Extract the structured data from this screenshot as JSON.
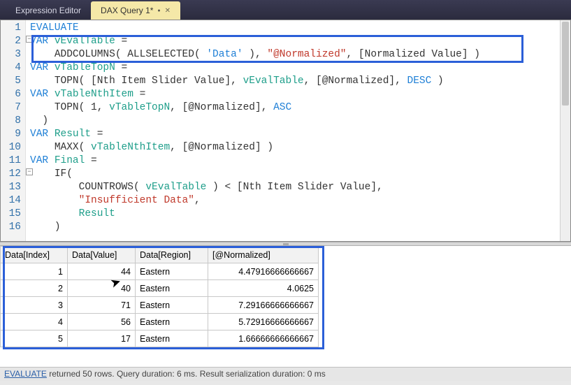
{
  "tabs": {
    "inactive": "Expression Editor",
    "active": "DAX Query 1*"
  },
  "code": {
    "lines": [
      [
        [
          "kw",
          "EVALUATE"
        ]
      ],
      [
        [
          "kw",
          "VAR"
        ],
        [
          "sp",
          " "
        ],
        [
          "ident",
          "vEvalTable"
        ],
        [
          "sp",
          " "
        ],
        [
          "op",
          "="
        ]
      ],
      [
        [
          "sp",
          "    "
        ],
        [
          "func",
          "ADDCOLUMNS"
        ],
        [
          "paren",
          "("
        ],
        [
          "sp",
          " "
        ],
        [
          "func",
          "ALLSELECTED"
        ],
        [
          "paren",
          "("
        ],
        [
          "sp",
          " "
        ],
        [
          "tbl",
          "'Data'"
        ],
        [
          "sp",
          " "
        ],
        [
          "paren",
          ")"
        ],
        [
          "op",
          ", "
        ],
        [
          "str",
          "\"@Normalized\""
        ],
        [
          "op",
          ", "
        ],
        [
          "col",
          "[Normalized Value]"
        ],
        [
          "sp",
          " "
        ],
        [
          "paren",
          ")"
        ]
      ],
      [
        [
          "kw",
          "VAR"
        ],
        [
          "sp",
          " "
        ],
        [
          "ident",
          "vTableTopN"
        ],
        [
          "sp",
          " "
        ],
        [
          "op",
          "="
        ]
      ],
      [
        [
          "sp",
          "    "
        ],
        [
          "func",
          "TOPN"
        ],
        [
          "paren",
          "("
        ],
        [
          "sp",
          " "
        ],
        [
          "col",
          "[Nth Item Slider Value]"
        ],
        [
          "op",
          ", "
        ],
        [
          "ident",
          "vEvalTable"
        ],
        [
          "op",
          ", "
        ],
        [
          "col",
          "[@Normalized]"
        ],
        [
          "op",
          ", "
        ],
        [
          "kw",
          "DESC"
        ],
        [
          "sp",
          " "
        ],
        [
          "paren",
          ")"
        ]
      ],
      [
        [
          "kw",
          "VAR"
        ],
        [
          "sp",
          " "
        ],
        [
          "ident",
          "vTableNthItem"
        ],
        [
          "sp",
          " "
        ],
        [
          "op",
          "="
        ]
      ],
      [
        [
          "sp",
          "    "
        ],
        [
          "func",
          "TOPN"
        ],
        [
          "paren",
          "("
        ],
        [
          "sp",
          " "
        ],
        [
          "num",
          "1"
        ],
        [
          "op",
          ", "
        ],
        [
          "ident",
          "vTableTopN"
        ],
        [
          "op",
          ", "
        ],
        [
          "col",
          "[@Normalized]"
        ],
        [
          "op",
          ", "
        ],
        [
          "kw",
          "ASC"
        ]
      ],
      [
        [
          "sp",
          "  "
        ],
        [
          "paren",
          ")"
        ]
      ],
      [
        [
          "kw",
          "VAR"
        ],
        [
          "sp",
          " "
        ],
        [
          "ident",
          "Result"
        ],
        [
          "sp",
          " "
        ],
        [
          "op",
          "="
        ]
      ],
      [
        [
          "sp",
          "    "
        ],
        [
          "func",
          "MAXX"
        ],
        [
          "paren",
          "("
        ],
        [
          "sp",
          " "
        ],
        [
          "ident",
          "vTableNthItem"
        ],
        [
          "op",
          ", "
        ],
        [
          "col",
          "[@Normalized]"
        ],
        [
          "sp",
          " "
        ],
        [
          "paren",
          ")"
        ]
      ],
      [
        [
          "kw",
          "VAR"
        ],
        [
          "sp",
          " "
        ],
        [
          "ident",
          "Final"
        ],
        [
          "sp",
          " "
        ],
        [
          "op",
          "="
        ]
      ],
      [
        [
          "sp",
          "    "
        ],
        [
          "func",
          "IF"
        ],
        [
          "paren",
          "("
        ]
      ],
      [
        [
          "sp",
          "        "
        ],
        [
          "func",
          "COUNTROWS"
        ],
        [
          "paren",
          "("
        ],
        [
          "sp",
          " "
        ],
        [
          "ident",
          "vEvalTable"
        ],
        [
          "sp",
          " "
        ],
        [
          "paren",
          ")"
        ],
        [
          "sp",
          " "
        ],
        [
          "op",
          "<"
        ],
        [
          "sp",
          " "
        ],
        [
          "col",
          "[Nth Item Slider Value]"
        ],
        [
          "op",
          ","
        ]
      ],
      [
        [
          "sp",
          "        "
        ],
        [
          "brstr",
          "\"Insufficient Data\""
        ],
        [
          "op",
          ","
        ]
      ],
      [
        [
          "sp",
          "        "
        ],
        [
          "ident",
          "Result"
        ]
      ],
      [
        [
          "sp",
          "    "
        ],
        [
          "paren",
          ")"
        ]
      ]
    ]
  },
  "results": {
    "headers": [
      "Data[Index]",
      "Data[Value]",
      "Data[Region]",
      "[@Normalized]"
    ],
    "rows": [
      {
        "index": "1",
        "value": "44",
        "region": "Eastern",
        "norm": "4.47916666666667"
      },
      {
        "index": "2",
        "value": "40",
        "region": "Eastern",
        "norm": "4.0625"
      },
      {
        "index": "3",
        "value": "71",
        "region": "Eastern",
        "norm": "7.29166666666667"
      },
      {
        "index": "4",
        "value": "56",
        "region": "Eastern",
        "norm": "5.72916666666667"
      },
      {
        "index": "5",
        "value": "17",
        "region": "Eastern",
        "norm": "1.66666666666667"
      }
    ]
  },
  "status": {
    "eval": "EVALUATE",
    "rest": " returned 50 rows. Query duration: 6 ms. Result serialization duration: 0 ms"
  }
}
